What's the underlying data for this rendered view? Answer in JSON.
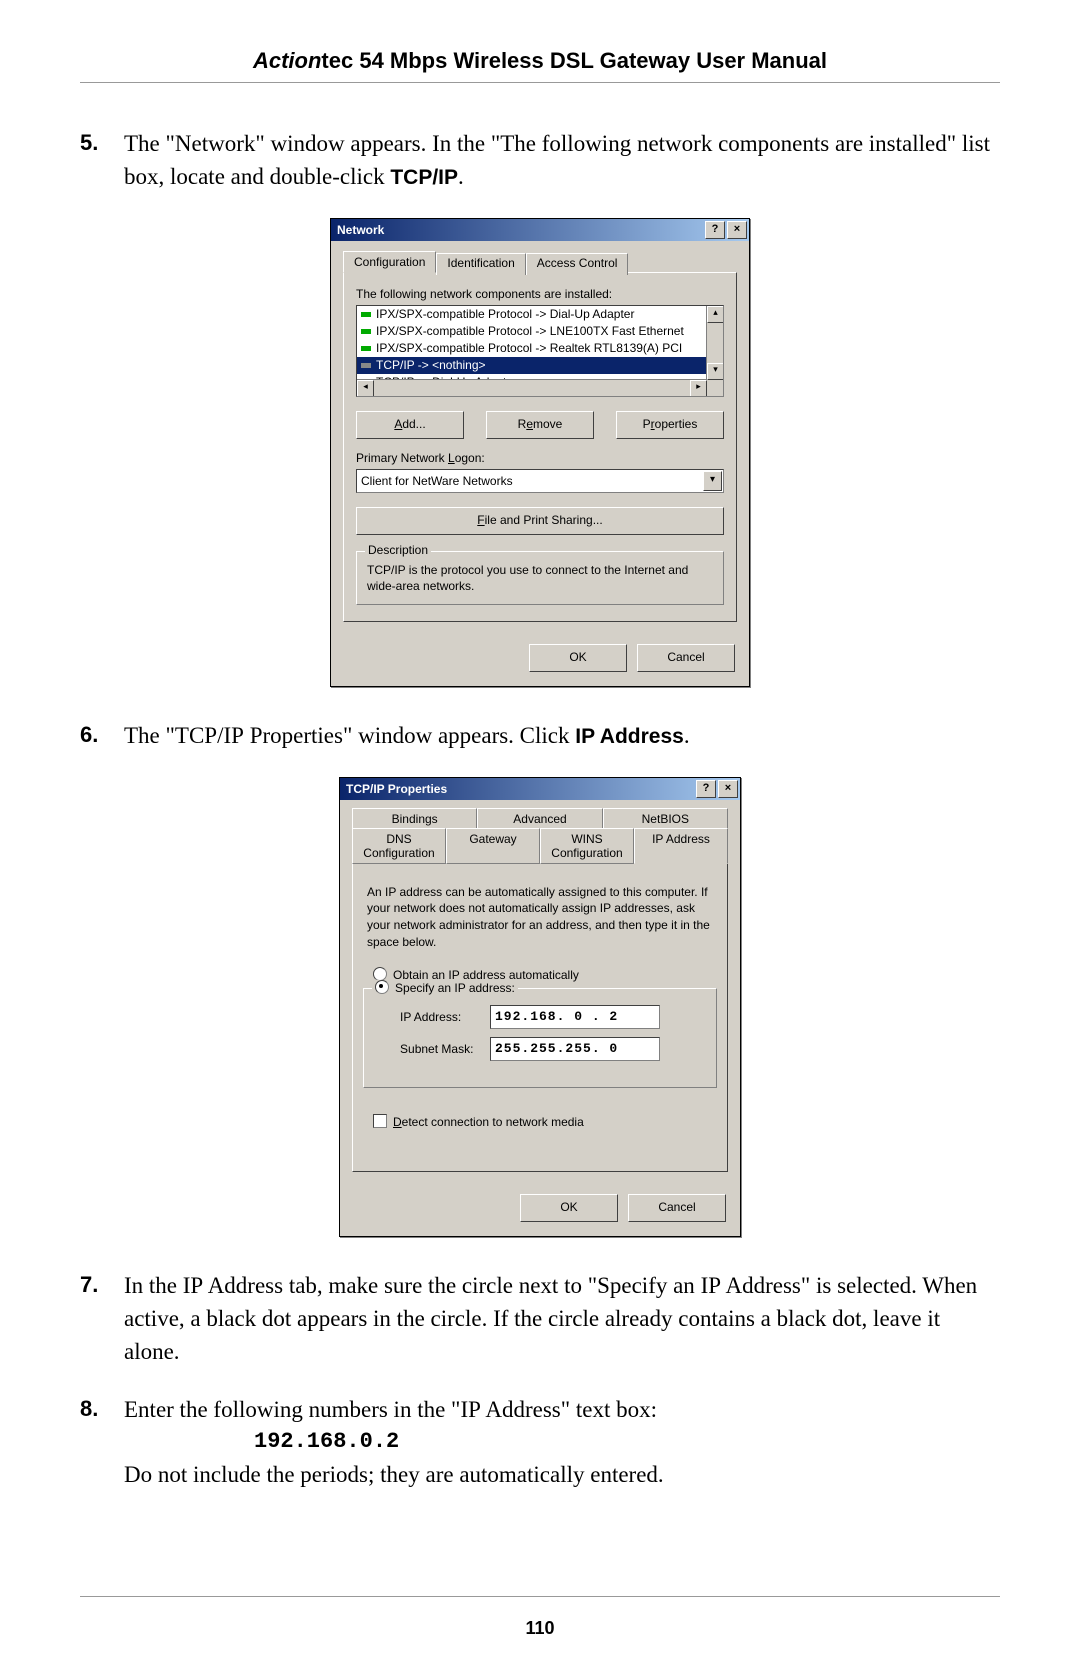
{
  "header": {
    "brand": "Action",
    "title_rest": "tec 54 Mbps Wireless DSL Gateway User Manual"
  },
  "steps": {
    "s5": {
      "num": "5.",
      "text_a": "The \"Network\" window appears. In the \"The following network components are installed\" list box, locate and double-click ",
      "bold": "TCP/IP",
      "text_b": "."
    },
    "s6": {
      "num": "6.",
      "text_a": "The \"",
      "sc1": "TCP/IP",
      "text_b": " Properties\" window appears. Click ",
      "bold": "IP Address",
      "text_c": "."
    },
    "s7": {
      "num": "7.",
      "text_a": "In the ",
      "sc1": "IP",
      "text_b": " Address tab, make sure the circle next to \"Specify an ",
      "sc2": "IP",
      "text_c": " Address\" is selected. When active, a black dot appears in the circle. If the circle already contains a black dot, leave it alone."
    },
    "s8": {
      "num": "8.",
      "text_a": "Enter the following numbers in the \"",
      "sc1": "IP",
      "text_b": " Address\" text box:",
      "ip": "192.168.0.2",
      "text_c": "Do not include the periods; they are automatically entered."
    }
  },
  "dialog1": {
    "title": "Network",
    "help": "?",
    "close": "×",
    "tabs": {
      "t1": "Configuration",
      "t2": "Identification",
      "t3": "Access Control"
    },
    "list_label": "The following network components are installed:",
    "rows": {
      "r1": "IPX/SPX-compatible Protocol -> Dial-Up Adapter",
      "r2": "IPX/SPX-compatible Protocol -> LNE100TX Fast Ethernet",
      "r3": "IPX/SPX-compatible Protocol -> Realtek RTL8139(A) PCI",
      "r4": "TCP/IP -> <nothing>",
      "r5": "TCP/IP -> Dial-Up Adapter"
    },
    "btn_add": "Add...",
    "btn_remove": "Remove",
    "btn_props": "Properties",
    "logon_label": "Primary Network Logon:",
    "logon_value": "Client for NetWare Networks",
    "file_print": "File and Print Sharing...",
    "desc_legend": "Description",
    "desc_text": "TCP/IP is the protocol you use to connect to the Internet and wide-area networks.",
    "ok": "OK",
    "cancel": "Cancel"
  },
  "dialog2": {
    "title": "TCP/IP Properties",
    "help": "?",
    "close": "×",
    "tabs_top": {
      "t1": "Bindings",
      "t2": "Advanced",
      "t3": "NetBIOS"
    },
    "tabs_bot": {
      "t1": "DNS Configuration",
      "t2": "Gateway",
      "t3": "WINS Configuration",
      "t4": "IP Address"
    },
    "info": "An IP address can be automatically assigned to this computer. If your network does not automatically assign IP addresses, ask your network administrator for an address, and then type it in the space below.",
    "opt_auto": "Obtain an IP address automatically",
    "opt_specify": "Specify an IP address:",
    "ip_label": "IP Address:",
    "ip_value": "192.168. 0 . 2",
    "mask_label": "Subnet Mask:",
    "mask_value": "255.255.255. 0",
    "detect": "Detect connection to network media",
    "ok": "OK",
    "cancel": "Cancel"
  },
  "page_number": "110"
}
